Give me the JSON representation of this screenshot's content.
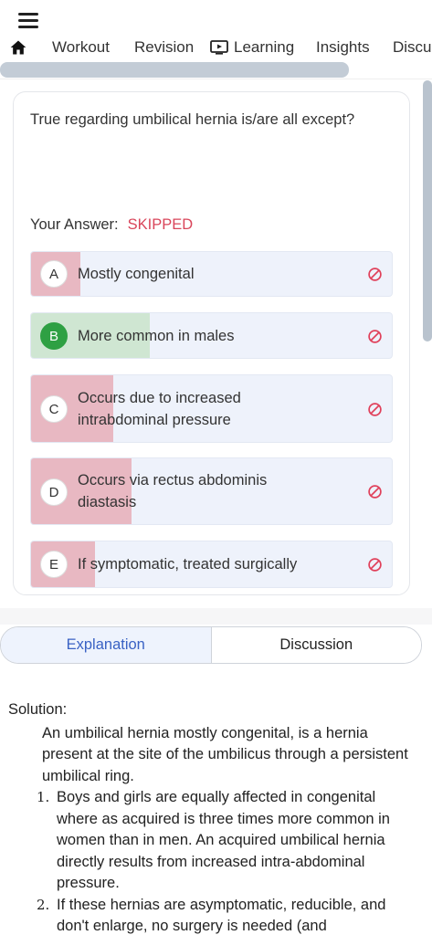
{
  "nav": {
    "tabs": [
      "Workout",
      "Revision",
      "Learning",
      "Insights",
      "Discu"
    ]
  },
  "question": {
    "text": "True regarding umbilical hernia is/are all except?",
    "answer_label": "Your Answer:",
    "answer_value": "SKIPPED",
    "options": [
      {
        "letter": "A",
        "line1": "Mostly congenital",
        "line2": "",
        "fill_fraction": 0.14,
        "correct": false
      },
      {
        "letter": "B",
        "line1": "More common in males",
        "line2": "",
        "fill_fraction": 0.33,
        "correct": true
      },
      {
        "letter": "C",
        "line1": "Occurs due to increased",
        "line2": "intrabdominal pressure",
        "fill_fraction": 0.23,
        "correct": false
      },
      {
        "letter": "D",
        "line1": "Occurs via rectus abdominis",
        "line2": "diastasis",
        "fill_fraction": 0.28,
        "correct": false
      },
      {
        "letter": "E",
        "line1": "If symptomatic, treated surgically",
        "line2": "",
        "fill_fraction": 0.18,
        "correct": false
      }
    ]
  },
  "segmented": {
    "explanation": "Explanation",
    "discussion": "Discussion"
  },
  "solution": {
    "title": "Solution:",
    "intro": "An umbilical hernia mostly congenital, is a hernia present at the site of the umbilicus through a persistent umbilical ring.",
    "points": [
      {
        "num": "1.",
        "text": "Boys and girls are equally affected in congenital where as acquired is three times more common in women than in men. An acquired umbilical hernia directly results from increased intra-abdominal pressure."
      },
      {
        "num": "2.",
        "text": "If these hernias are asymptomatic, reducible, and don't enlarge, no surgery is needed (and"
      }
    ]
  },
  "colors": {
    "wrong_fill": "#e8b8c2",
    "correct_fill": "#cfe6d2",
    "skipped": "#d9455a",
    "accent": "#3a62c4",
    "correct_badge": "#2ea043"
  }
}
